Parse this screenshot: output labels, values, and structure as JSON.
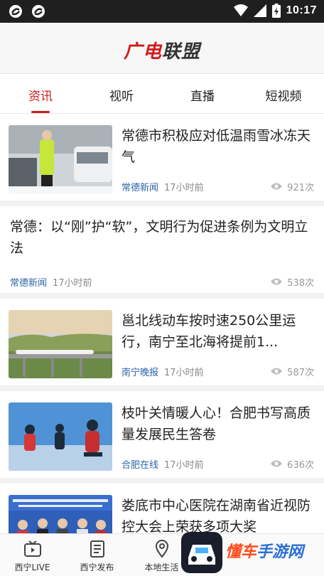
{
  "statusbar": {
    "time": "10:17"
  },
  "app": {
    "logo_part1": "广电",
    "logo_part2": "联盟"
  },
  "tabs": [
    {
      "label": "资讯",
      "active": true
    },
    {
      "label": "视听",
      "active": false
    },
    {
      "label": "直播",
      "active": false
    },
    {
      "label": "短视频",
      "active": false
    }
  ],
  "feed": [
    {
      "title": "常德市积极应对低温雨雪冰冻天气",
      "source": "常德新闻",
      "time": "17小时前",
      "views": "921次",
      "image": "traffic-police-snow"
    },
    {
      "title": "常德：以“刚”护“软”，文明行为促进条例为文明立法",
      "source": "常德新闻",
      "time": "17小时前",
      "views": "538次",
      "image": ""
    },
    {
      "title": "邕北线动车按时速250公里运行，南宁至北海将提前1...",
      "source": "南宁晚报",
      "time": "17小时前",
      "views": "587次",
      "image": "bullet-train-bridge"
    },
    {
      "title": "枝叶关情暖人心！合肥书写高质量发展民生答卷",
      "source": "合肥在线",
      "time": "17小时前",
      "views": "636次",
      "image": "kids-roller-skating"
    },
    {
      "title": "娄底市中心医院在湖南省近视防控大会上荣获多项大奖",
      "source": "",
      "time": "",
      "views": "",
      "image": "award-ceremony"
    }
  ],
  "bottom_nav": [
    {
      "label": "西宁LIVE",
      "icon": "tv-icon"
    },
    {
      "label": "西宁发布",
      "icon": "document-icon"
    },
    {
      "label": "本地生活",
      "icon": "location-pin-icon"
    }
  ],
  "watermark": {
    "text_part1": "懂车",
    "text_part2": "手游网"
  },
  "colors": {
    "accent": "#d01b1b",
    "source": "#2b64a8",
    "statusbar": "#1f1f1f"
  }
}
